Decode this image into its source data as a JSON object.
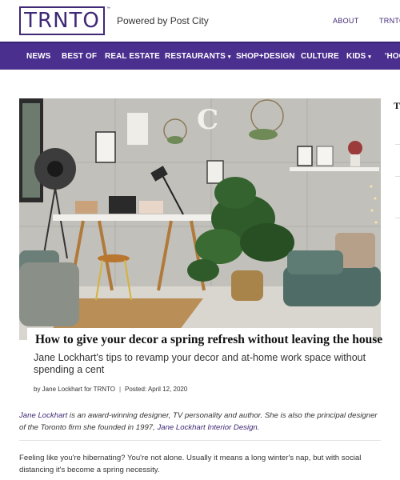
{
  "header": {
    "logo": "TRNTO",
    "logo_tm": "™",
    "powered_by": "Powered by Post City",
    "links": [
      "ABOUT",
      "TRNTO"
    ]
  },
  "nav": {
    "items": [
      {
        "label": "NEWS"
      },
      {
        "label": "BEST OF"
      },
      {
        "label": "REAL ESTATE"
      },
      {
        "label": "RESTAURANTS",
        "caret": "▾"
      },
      {
        "label": "SHOP+DESIGN"
      },
      {
        "label": "CULTURE"
      },
      {
        "label": "KIDS",
        "caret": "▾"
      },
      {
        "label": "'HOO"
      }
    ]
  },
  "article": {
    "title": "How to give your decor a spring refresh without leaving the house",
    "subtitle": "Jane Lockhart's tips to revamp your decor and at-home work space without spending a cent",
    "byline_author": "by Jane Lockhart for TRNTO",
    "byline_sep": "|",
    "byline_date": "Posted: April 12, 2020",
    "intro_link_1": "Jane Lockhart",
    "intro_text_1": " is an award-winning designer, TV personality and author. She is also the principal designer of the Toronto firm she founded in 1997, ",
    "intro_link_2": "Jane Lockhart Interior Design",
    "intro_text_2": ".",
    "paragraph_1": "Feeling like you're hibernating? You're not alone. Usually it means a long winter's nap, but with social distancing it's become a spring necessity."
  },
  "sidebar": {
    "peek_letter": "T"
  },
  "colors": {
    "brand_purple": "#4b2f8f",
    "logo_purple": "#3f2875"
  }
}
